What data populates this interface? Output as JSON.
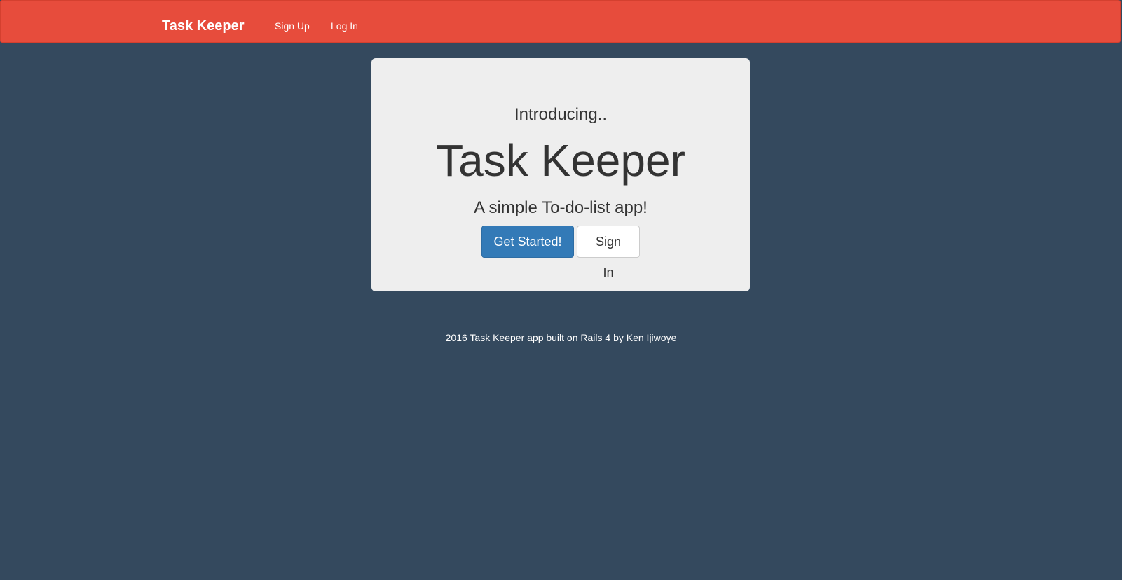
{
  "navbar": {
    "brand": "Task Keeper",
    "links": [
      {
        "label": "Sign Up"
      },
      {
        "label": "Log In"
      }
    ]
  },
  "hero": {
    "intro": "Introducing..",
    "title": "Task Keeper",
    "tagline": "A simple To-do-list app!",
    "primary_button": "Get Started!",
    "secondary_button": "Sign In"
  },
  "footer": {
    "text": "2016 Task Keeper app built on Rails 4 by Ken Ijiwoye"
  },
  "colors": {
    "navbar": "#e74c3c",
    "background": "#34495e",
    "panel": "#eeeeee",
    "primary_button": "#337ab7"
  }
}
